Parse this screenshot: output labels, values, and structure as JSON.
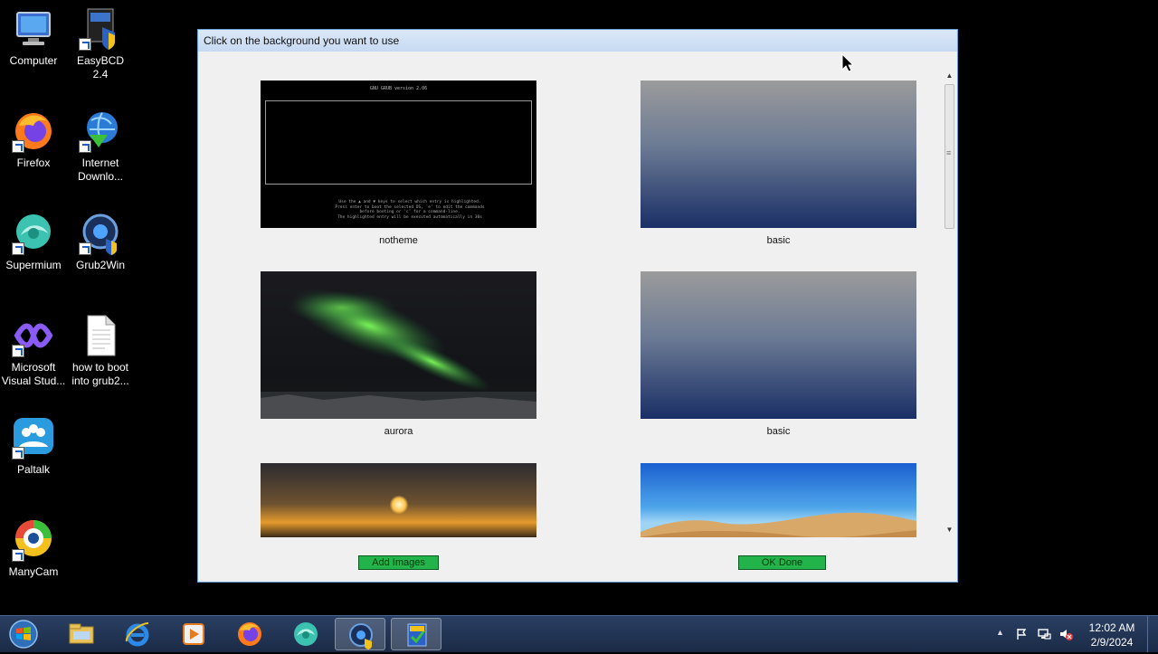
{
  "desktop": {
    "icons": [
      {
        "label": "Computer",
        "icon": "computer-icon"
      },
      {
        "label": "EasyBCD 2.4",
        "icon": "easybcd-icon"
      },
      {
        "label": "Firefox",
        "icon": "firefox-icon"
      },
      {
        "label": "Internet Downlo...",
        "icon": "internet-download-manager-icon"
      },
      {
        "label": "Supermium",
        "icon": "supermium-icon"
      },
      {
        "label": "Grub2Win",
        "icon": "grub2win-icon"
      },
      {
        "label": "Microsoft Visual Stud...",
        "icon": "visual-studio-icon"
      },
      {
        "label": "how to boot into grub2...",
        "icon": "text-file-icon"
      },
      {
        "label": "Paltalk",
        "icon": "paltalk-icon"
      },
      {
        "label": "ManyCam",
        "icon": "manycam-icon"
      }
    ]
  },
  "dialog": {
    "title": "Click on the background you want to use",
    "thumbnails": [
      {
        "caption": "notheme",
        "preview": "grub-black-screen",
        "grub_header": "GNU GRUB  version 2.06",
        "grub_help": [
          "Use the ▲ and ▼ keys to select which entry is highlighted.",
          "Press enter to boot the selected OS, 'e' to edit the commands",
          "before booting or 'c' for a command-line.",
          "The highlighted entry will be executed automatically in 30s"
        ]
      },
      {
        "caption": "basic",
        "preview": "gray-to-navy-gradient"
      },
      {
        "caption": "aurora",
        "preview": "aurora-night-sky"
      },
      {
        "caption": "basic",
        "preview": "gray-to-navy-gradient"
      },
      {
        "caption": "",
        "preview": "sunset-over-water"
      },
      {
        "caption": "",
        "preview": "blue-sky-desert"
      }
    ],
    "add_images_label": "Add Images",
    "ok_done_label": "OK Done",
    "button_color": "#22b34a"
  },
  "taskbar": {
    "clock_time": "12:02 AM",
    "clock_date": "2/9/2024",
    "pinned": [
      "windows-explorer-icon",
      "internet-explorer-icon",
      "media-player-icon",
      "firefox-icon",
      "supermium-icon",
      "grub2win-icon",
      "easybcd-icon"
    ]
  }
}
